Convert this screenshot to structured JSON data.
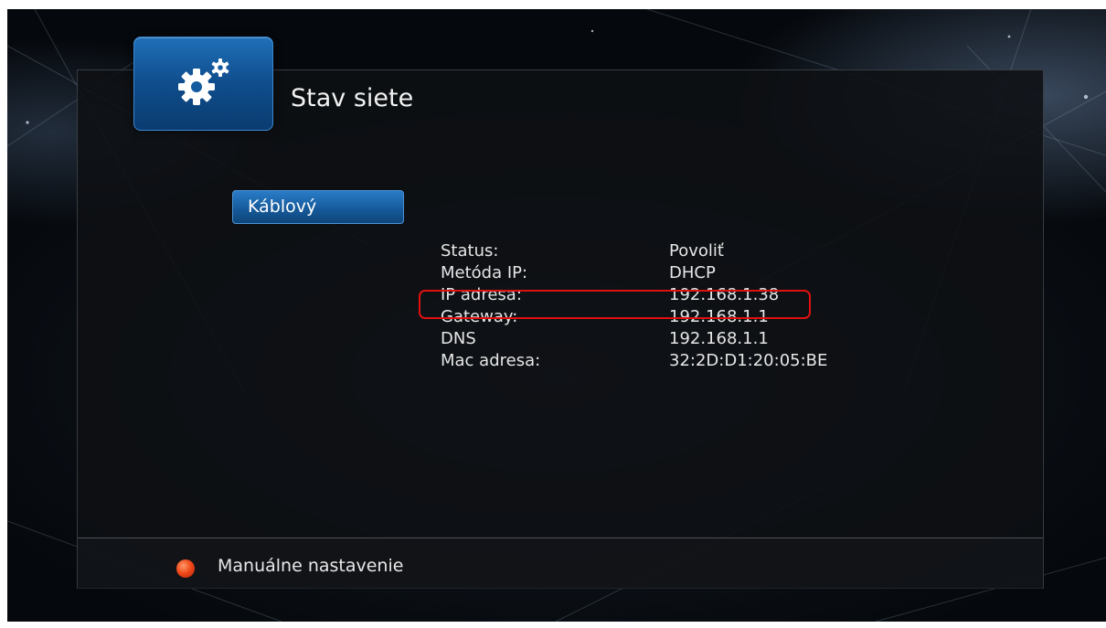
{
  "header": {
    "title": "Stav siete",
    "icon": "gears-icon"
  },
  "tabs": [
    {
      "label": "Káblový",
      "selected": true
    }
  ],
  "network_info": {
    "rows": [
      {
        "label": "Status:",
        "value": "Povoliť"
      },
      {
        "label": "Metóda IP:",
        "value": "DHCP"
      },
      {
        "label": "IP adresa:",
        "value": "192.168.1.38",
        "highlighted": true
      },
      {
        "label": "Gateway:",
        "value": "192.168.1.1"
      },
      {
        "label": "DNS",
        "value": "192.168.1.1"
      },
      {
        "label": "Mac adresa:",
        "value": "32:2D:D1:20:05:BE"
      }
    ]
  },
  "footer": {
    "red_button_label": "Manuálne nastavenie",
    "red_button_icon": "red-dot-icon"
  },
  "colors": {
    "accent_blue": "#1f6fb8",
    "highlight_red": "#e01010",
    "red_button": "#f04a1a"
  }
}
